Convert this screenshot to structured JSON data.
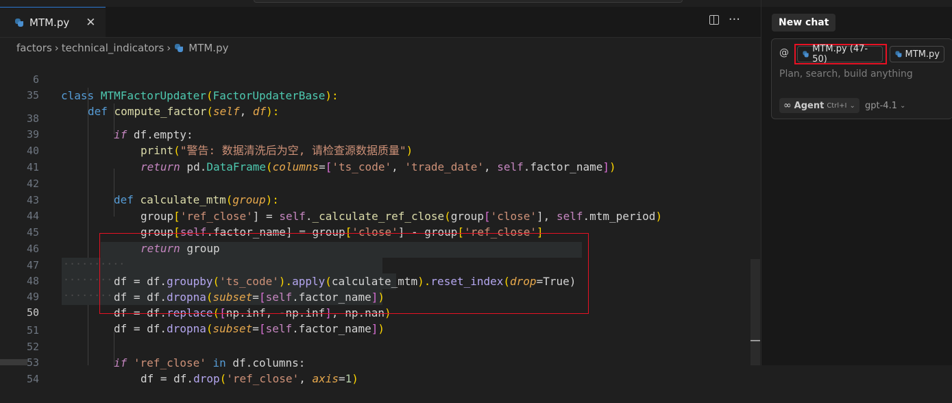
{
  "tab": {
    "label": "MTM.py",
    "close": "✕"
  },
  "actions": {
    "more": "···"
  },
  "breadcrumb": [
    "factors",
    "technical_indicators",
    "MTM.py"
  ],
  "breadcrumb_sep": "›",
  "code": {
    "l6": {
      "n": "6",
      "t": [
        "class",
        " ",
        "MTMFactorUpdater",
        "(",
        "FactorUpdaterBase",
        "):"
      ]
    },
    "l35": {
      "n": "35",
      "t": [
        "def",
        " ",
        "compute_factor",
        "(",
        "self",
        ", ",
        "df",
        "):"
      ]
    },
    "l38": {
      "n": "38",
      "t": [
        "if",
        " df.empty:"
      ]
    },
    "l39": {
      "n": "39",
      "t": [
        "print",
        "(",
        "\"警告: 数据清洗后为空, 请检查源数据质量\"",
        ")"
      ]
    },
    "l40": {
      "n": "40",
      "t": [
        "return",
        " pd.",
        "DataFrame",
        "(",
        "columns",
        "=",
        "[",
        "'ts_code'",
        ", ",
        "'trade_date'",
        ", ",
        "self",
        ".factor_name",
        "]",
        ")"
      ]
    },
    "l41": {
      "n": "41"
    },
    "l42": {
      "n": "42",
      "t": [
        "def",
        " ",
        "calculate_mtm",
        "(",
        "group",
        "):"
      ]
    },
    "l43": {
      "n": "43",
      "t": [
        "group",
        "[",
        "'ref_close'",
        "] = ",
        "self",
        ".",
        "_calculate_ref_close",
        "(",
        "group",
        "[",
        "'close'",
        "], ",
        "self",
        ".mtm_period",
        ")"
      ]
    },
    "l44": {
      "n": "44",
      "t": [
        "group",
        "[",
        "self",
        ".factor_name",
        "] = group",
        "[",
        "'close'",
        "] - group",
        "[",
        "'ref_close'",
        "]"
      ]
    },
    "l45": {
      "n": "45",
      "t": [
        "return",
        " group"
      ]
    },
    "l46": {
      "n": "46"
    },
    "l47": {
      "n": "47",
      "t": [
        "df = df.",
        "groupby",
        "(",
        "'ts_code'",
        ").",
        "apply",
        "(",
        "calculate_mtm",
        ").",
        "reset_index",
        "(",
        "drop",
        "=True)"
      ]
    },
    "l48": {
      "n": "48",
      "t": [
        "df = df.",
        "dropna",
        "(",
        "subset",
        "=",
        "[",
        "self",
        ".factor_name",
        "]",
        ")"
      ]
    },
    "l49": {
      "n": "49",
      "t": [
        "df = df.",
        "replace",
        "(",
        "[",
        "np.inf, -np.inf",
        "]",
        ", np.nan",
        ")"
      ]
    },
    "l50": {
      "n": "50",
      "t": [
        "df = df.",
        "dropna",
        "(",
        "subset",
        "=",
        "[",
        "self",
        ".factor_name",
        "]",
        ")"
      ]
    },
    "l51": {
      "n": "51"
    },
    "l52": {
      "n": "52",
      "t": [
        "if",
        " ",
        "'ref_close'",
        " ",
        "in",
        " df.columns:"
      ]
    },
    "l53": {
      "n": "53",
      "t": [
        "df = df.",
        "drop",
        "(",
        "'ref_close'",
        ", ",
        "axis",
        "=",
        "1",
        ")"
      ]
    },
    "l54": {
      "n": "54"
    }
  },
  "chat": {
    "new_chat": "New chat",
    "at": "@",
    "chip1": "MTM.py (47-50)",
    "chip2": "MTM.py",
    "placeholder": "Plan, search, build anything",
    "agent": "Agent",
    "agent_shortcut": "Ctrl+I",
    "model": "gpt-4.1"
  },
  "colors": {
    "accent": "#2b79d3",
    "highlight_box": "#e81123"
  }
}
